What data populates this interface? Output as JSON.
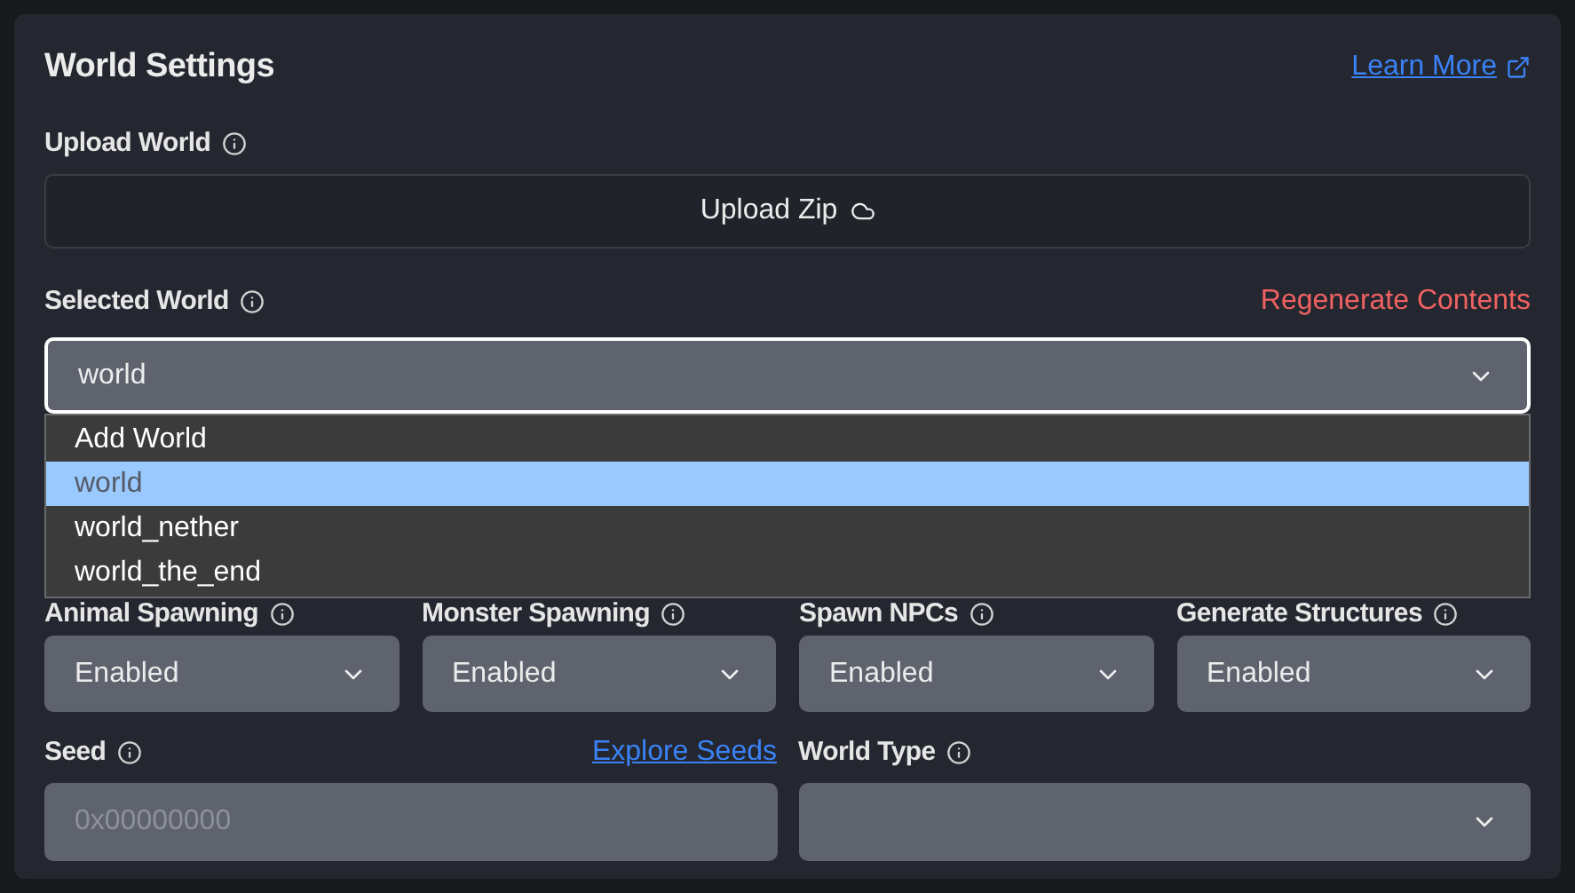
{
  "card": {
    "title": "World Settings",
    "learn_more": "Learn More"
  },
  "upload": {
    "label": "Upload World",
    "button": "Upload Zip"
  },
  "selected_world": {
    "label": "Selected World",
    "action": "Regenerate Contents",
    "value": "world",
    "expanded": true,
    "options": [
      {
        "label": "Add World",
        "selected": false
      },
      {
        "label": "world",
        "selected": true
      },
      {
        "label": "world_nether",
        "selected": false
      },
      {
        "label": "world_the_end",
        "selected": false
      }
    ]
  },
  "toggles": [
    {
      "label": "Animal Spawning",
      "value": "Enabled"
    },
    {
      "label": "Monster Spawning",
      "value": "Enabled"
    },
    {
      "label": "Spawn NPCs",
      "value": "Enabled"
    },
    {
      "label": "Generate Structures",
      "value": "Enabled"
    }
  ],
  "seed": {
    "label": "Seed",
    "link": "Explore Seeds",
    "placeholder": "0x00000000"
  },
  "world_type": {
    "label": "World Type"
  }
}
